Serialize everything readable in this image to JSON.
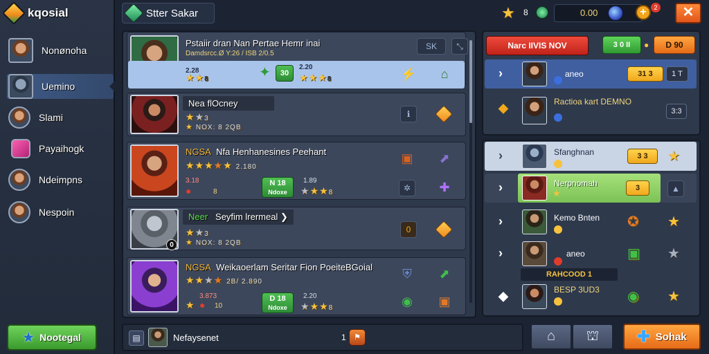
{
  "app": {
    "logo_text": "kqosial"
  },
  "sidebar": {
    "items": [
      {
        "label": "Nonønoha",
        "icon": "hero-avatar"
      },
      {
        "label": "Uemino",
        "icon": "hero-avatar"
      },
      {
        "label": "Slami",
        "icon": "hero-avatar"
      },
      {
        "label": "Payaihogk",
        "icon": "heart-badge-icon"
      },
      {
        "label": "Ndeimpns",
        "icon": "hero-avatar"
      },
      {
        "label": "Nespoin",
        "icon": "hero-avatar"
      }
    ],
    "new_button_label": "Nootegal"
  },
  "header": {
    "search_text": "Stter Sakar",
    "star_count": "8",
    "coin_value": "0.00",
    "notif_count": "2",
    "close_label": "✕"
  },
  "list": {
    "cards": [
      {
        "title": "Pstaiir dran Nan Pertae Hemr inai",
        "subtitle": "Damdsrcc.Ø Y:26 / ISB 2/0.5",
        "level": "8",
        "lv_a": "2.28",
        "lv_b": "8",
        "pill": "30",
        "lv_c": "2.20",
        "lv_d": "8"
      },
      {
        "title": "Nea flOcney",
        "subtitle": "NOX: 8 2QB",
        "level": "",
        "stars_label": "3"
      },
      {
        "title_prefix": "NGSA",
        "title": "Nfa Henhanesines Peehant",
        "subtitle": "2.180",
        "level": "",
        "lv_a": "3.18",
        "lv_b": "8",
        "pill": "N 18",
        "pill_sub": "Ndoxe",
        "lv_c": "1.89",
        "lv_d": "8"
      },
      {
        "title_prefix": "Neer",
        "title": "Seyfim lrermeal",
        "subtitle": "NOX: 8 2QB",
        "level": "0",
        "stars_label": "3"
      },
      {
        "title_prefix": "NGSA",
        "title": "Weikaoerlam Seritar Fion PoeiteBGoial",
        "subtitle": "2B/ 2.890",
        "level": "",
        "lv_a": "3.873",
        "lv_b": "10",
        "pill": "D 18",
        "pill_sub": "Ndoxe",
        "lv_c": "2.20",
        "lv_d": "8"
      }
    ],
    "side_button": "SK"
  },
  "bottom": {
    "label": "Nefaysenet",
    "count": "1",
    "action_label": "Sohak"
  },
  "right": {
    "red_button": "Narc IIVIS NOV",
    "green_chip": "3 0 II",
    "orange_chip": "D 90",
    "rows_top": [
      {
        "name": "aneo",
        "badge": "31 3",
        "badge2": "1 T"
      },
      {
        "name": "Ractioa kart DEMNO",
        "badge2": "3:3"
      }
    ],
    "rows_bottom": [
      {
        "name": "Sfanghnan",
        "badge": "3 3"
      },
      {
        "name": "Nerpnomah",
        "badge": "3"
      },
      {
        "name": "Kemo Bnten"
      },
      {
        "name": "aneo"
      },
      {
        "name": "BESP 3UD3"
      }
    ],
    "banner": "RAHCOOD 1"
  }
}
